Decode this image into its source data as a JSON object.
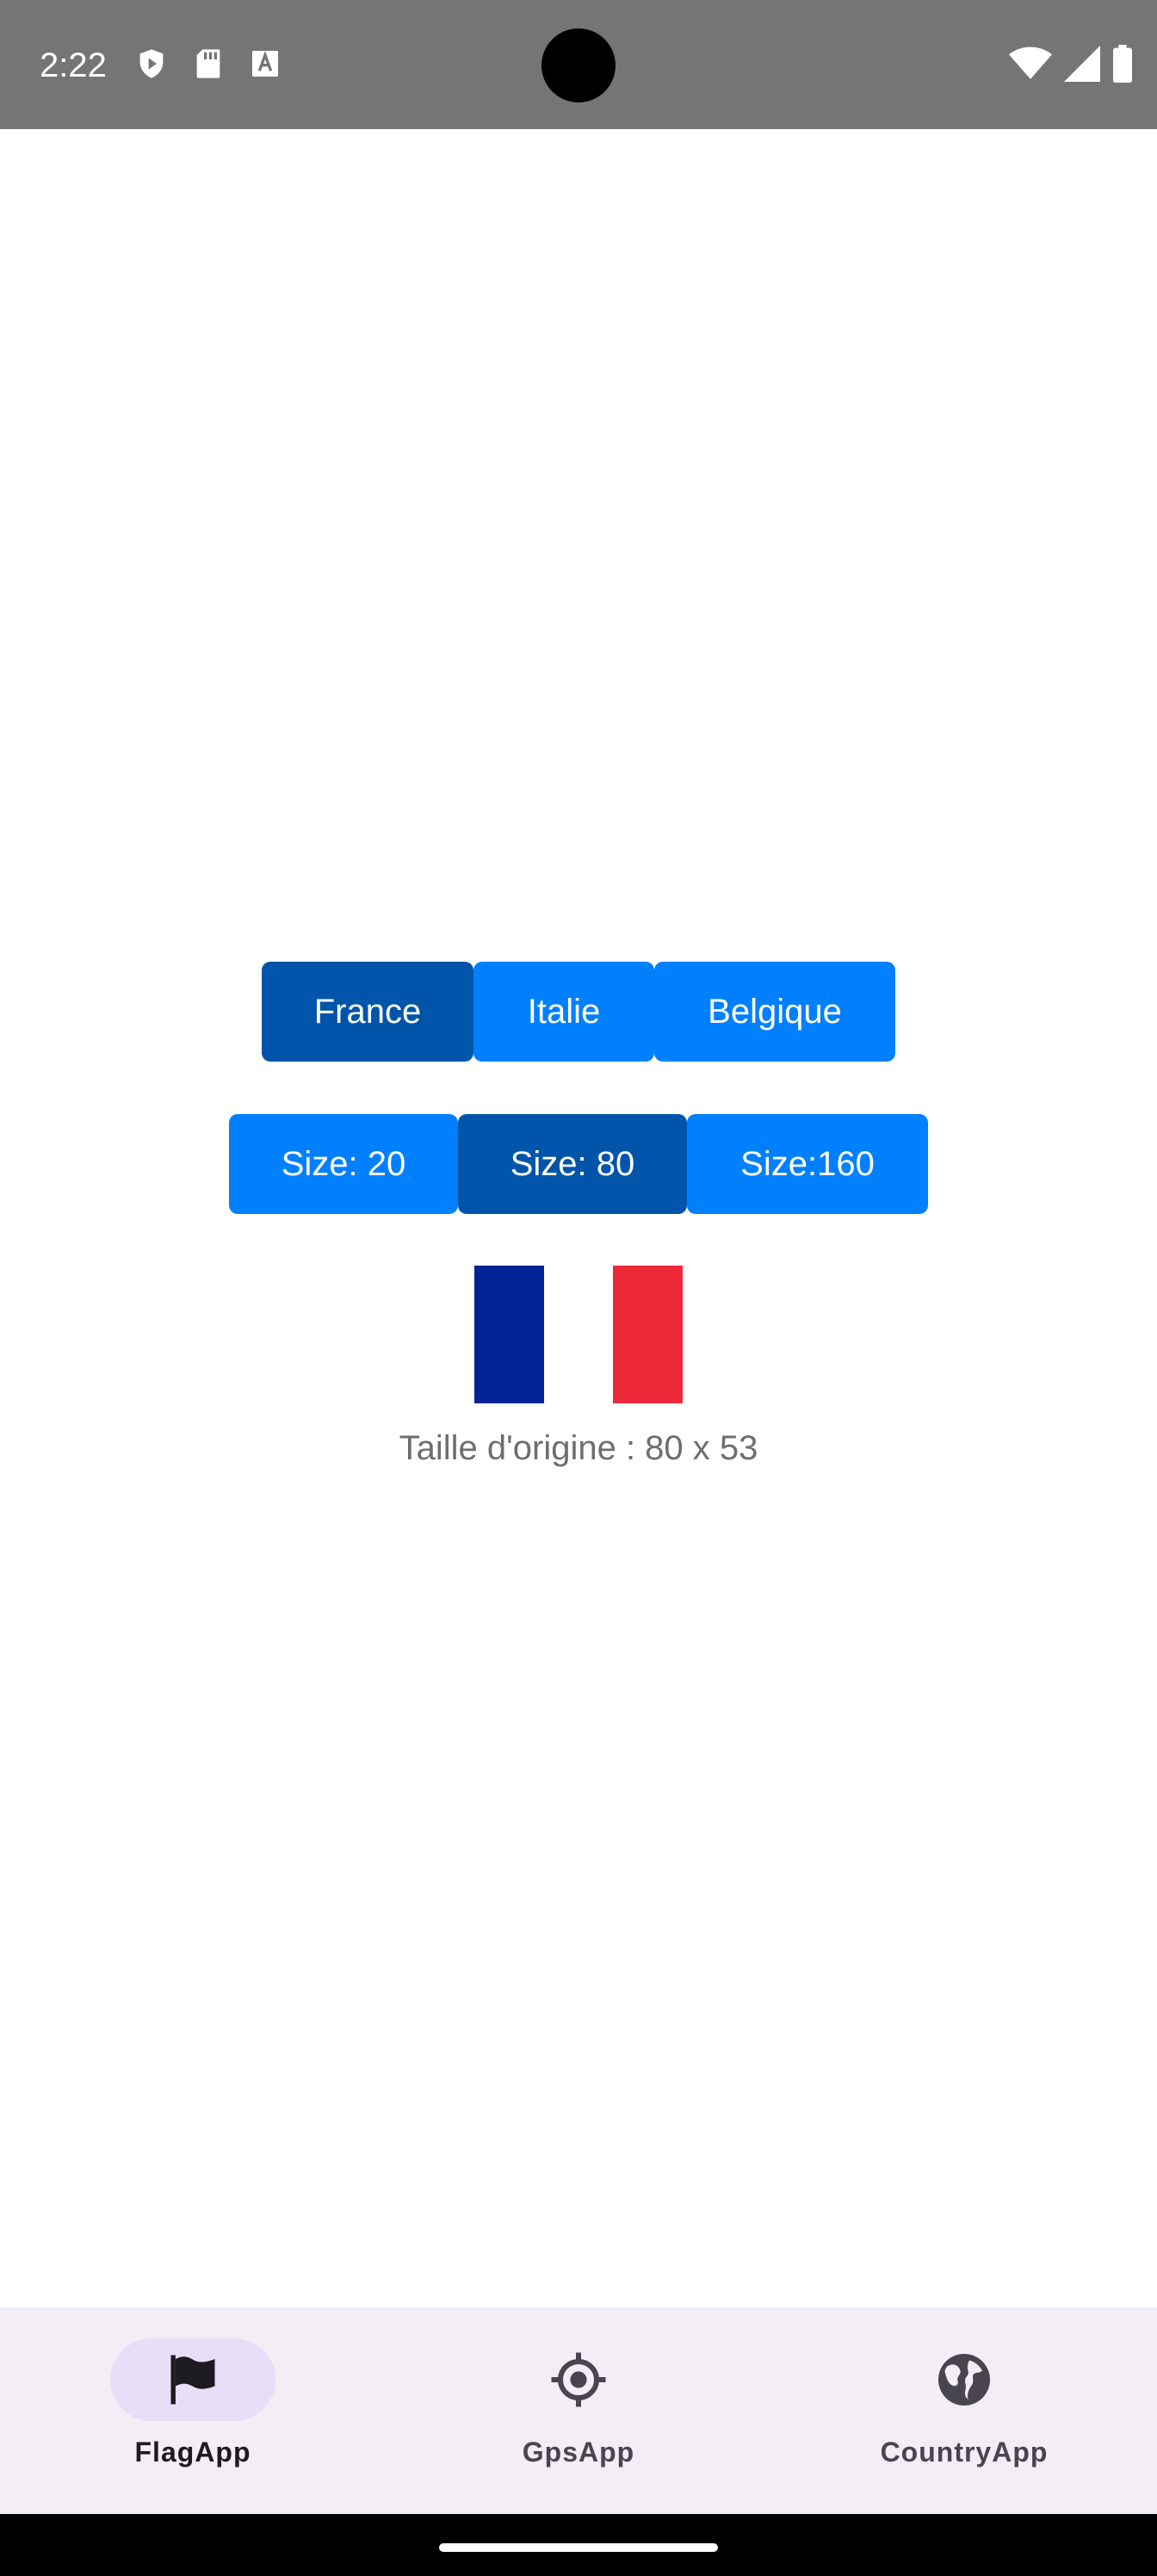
{
  "status_bar": {
    "time": "2:22",
    "icons_left": [
      "shield-play-icon",
      "sd-card-icon",
      "font-a-icon"
    ],
    "icons_right": [
      "wifi-icon",
      "signal-icon",
      "battery-icon"
    ],
    "background": "#757575"
  },
  "country_buttons": [
    {
      "label": "France",
      "selected": true
    },
    {
      "label": "Italie",
      "selected": false
    },
    {
      "label": "Belgique",
      "selected": false
    }
  ],
  "size_buttons": [
    {
      "label": "Size: 20",
      "selected": false
    },
    {
      "label": "Size: 80",
      "selected": true
    },
    {
      "label": "Size:160",
      "selected": false
    }
  ],
  "flag": {
    "country": "France",
    "colors": [
      "#002395",
      "#ffffff",
      "#ed2939"
    ]
  },
  "caption": "Taille d'origine : 80 x 53",
  "bottom_nav": {
    "items": [
      {
        "label": "FlagApp",
        "icon": "flag-icon",
        "active": true
      },
      {
        "label": "GpsApp",
        "icon": "gps-target-icon",
        "active": false
      },
      {
        "label": "CountryApp",
        "icon": "globe-icon",
        "active": false
      }
    ],
    "background": "#f3edf6",
    "active_pill": "#e8def8"
  },
  "colors": {
    "button_normal": "#0080ff",
    "button_selected": "#0055aa"
  }
}
